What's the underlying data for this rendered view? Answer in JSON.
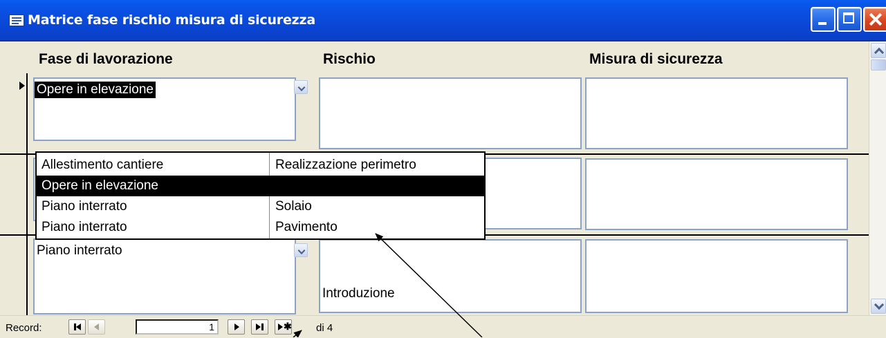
{
  "window": {
    "title": "Matrice fase rischio misura di sicurezza"
  },
  "columns": {
    "fase": "Fase di lavorazione",
    "rischio": "Rischio",
    "misura": "Misura di sicurezza"
  },
  "records": [
    {
      "fase": "Opere in elevazione",
      "rischio": "",
      "misura": "",
      "fase_selected": true
    },
    {
      "fase": "",
      "rischio": "",
      "misura": ""
    },
    {
      "fase": "Piano interrato",
      "rischio": "Introduzione",
      "misura": ""
    }
  ],
  "dropdown": {
    "rows": [
      {
        "col1": "Allestimento cantiere",
        "col2": "Realizzazione perimetro"
      },
      {
        "col1": "Opere in elevazione",
        "col2": "",
        "selected": true
      },
      {
        "col1": "Piano interrato",
        "col2": "Solaio"
      },
      {
        "col1": "Piano interrato",
        "col2": "Pavimento"
      }
    ]
  },
  "navigation": {
    "label": "Record:",
    "current": "1",
    "total": "di 4"
  },
  "icons": {
    "app": "form-icon",
    "minimize": "minimize-icon",
    "maximize": "maximize-icon",
    "close": "close-icon",
    "combo": "chevron-down-icon",
    "pointer": "record-pointer-icon",
    "arrow": "annotation-arrow-icon"
  },
  "colors": {
    "title_bar": "#0a52e6",
    "form_background": "#ece9d8",
    "field_border": "#8aa3c6",
    "selection": "#000000"
  }
}
